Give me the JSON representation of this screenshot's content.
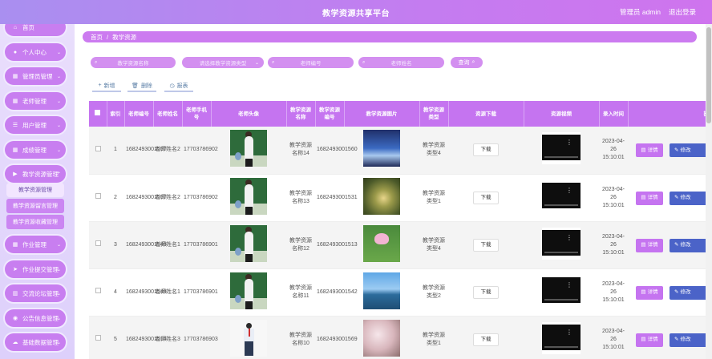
{
  "header": {
    "title": "教学资源共享平台",
    "user_text": "管理员 admin",
    "logout_label": "退出登录"
  },
  "sidebar": {
    "items": [
      {
        "label": "首页",
        "icon": "home-icon",
        "glyph": "⌂"
      },
      {
        "label": "个人中心",
        "icon": "user-icon",
        "glyph": "●"
      },
      {
        "label": "管理员管理",
        "icon": "grid-icon",
        "glyph": "▦"
      },
      {
        "label": "老师管理",
        "icon": "grid-icon",
        "glyph": "▦"
      },
      {
        "label": "用户管理",
        "icon": "list-icon",
        "glyph": "☰"
      },
      {
        "label": "成绩管理",
        "icon": "grid-icon",
        "glyph": "▦"
      },
      {
        "label": "教学资源管理",
        "icon": "video-icon",
        "glyph": "▶"
      },
      {
        "label": "作业管理",
        "icon": "grid-icon",
        "glyph": "▦"
      },
      {
        "label": "作业提交管理",
        "icon": "send-icon",
        "glyph": "➤"
      },
      {
        "label": "交流论坛管理",
        "icon": "chart-icon",
        "glyph": "▥"
      },
      {
        "label": "公告信息管理",
        "icon": "location-icon",
        "glyph": "◉"
      },
      {
        "label": "基础数据管理",
        "icon": "cloud-icon",
        "glyph": "☁"
      }
    ],
    "subitems": [
      "教学资源管理",
      "教学资源留言管理",
      "教学资源收藏管理"
    ]
  },
  "breadcrumb": {
    "home": "首页",
    "separator": "/",
    "current": "教学资源"
  },
  "search": {
    "resource_name_placeholder": "教学资源名称",
    "resource_type_placeholder": "请选择教学资源类型",
    "teacher_no_placeholder": "老师编号",
    "teacher_name_placeholder": "老师姓名",
    "query_label": "查询"
  },
  "actions": {
    "add_label": "新增",
    "delete_label": "删除",
    "report_label": "报表"
  },
  "table": {
    "headers": [
      "",
      "索引",
      "老师编号",
      "老师姓名",
      "老师手机号",
      "老师头像",
      "教学资源名称",
      "教学资源编号",
      "教学资源图片",
      "教学资源类型",
      "资源下载",
      "资源视频",
      "录入时间",
      "操作"
    ],
    "download_label": "下载",
    "detail_label": "详情",
    "edit_label": "修改",
    "rows": [
      {
        "index": "1",
        "teacher_no": "1682493001557",
        "teacher_name": "老师姓名2",
        "phone": "17703786902",
        "avatar": "teacher",
        "resource_name": "教学资源名称14",
        "resource_no": "1682493001560",
        "image": "sky",
        "resource_type": "教学资源类型4",
        "time": "2023-04-26 15:10:01"
      },
      {
        "index": "2",
        "teacher_no": "1682493001557",
        "teacher_name": "老师姓名2",
        "phone": "17703786902",
        "avatar": "teacher",
        "resource_name": "教学资源名称13",
        "resource_no": "1682493001531",
        "image": "forest",
        "resource_type": "教学资源类型1",
        "time": "2023-04-26 15:10:01"
      },
      {
        "index": "3",
        "teacher_no": "1682493001548",
        "teacher_name": "老师姓名1",
        "phone": "17703786901",
        "avatar": "teacher",
        "resource_name": "教学资源名称12",
        "resource_no": "1682493001513",
        "image": "lotus",
        "resource_type": "教学资源类型4",
        "time": "2023-04-26 15:10:01"
      },
      {
        "index": "4",
        "teacher_no": "1682493001548",
        "teacher_name": "老师姓名1",
        "phone": "17703786901",
        "avatar": "teacher",
        "resource_name": "教学资源名称11",
        "resource_no": "1682493001542",
        "image": "lake",
        "resource_type": "教学资源类型2",
        "time": "2023-04-26 15:10:01"
      },
      {
        "index": "5",
        "teacher_no": "1682493001514",
        "teacher_name": "老师姓名3",
        "phone": "17703786903",
        "avatar": "man",
        "resource_name": "教学资源名称10",
        "resource_no": "1682493001569",
        "image": "blossom",
        "resource_type": "教学资源类型1",
        "time": "2023-04-26 15:10:01"
      }
    ]
  },
  "colors": {
    "accent": "#c574f0",
    "edit": "#4b63c8",
    "header_start": "#a98ff0"
  }
}
